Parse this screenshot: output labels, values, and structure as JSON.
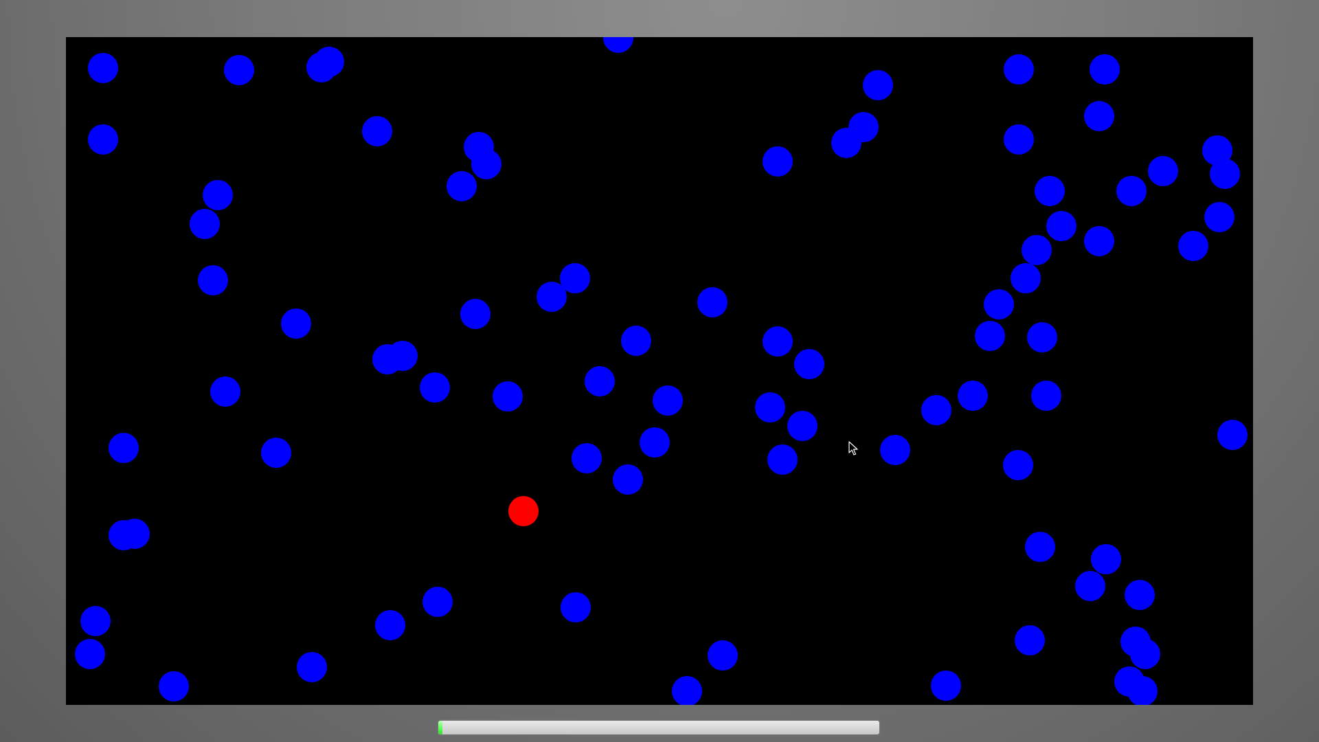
{
  "game": {
    "background_color": "#000000",
    "enemy_color": "#0000ff",
    "player_color": "#ff0000",
    "progress_fill_color": "#44ee44",
    "progress_fraction": 0.008,
    "dots_icon": "circle"
  }
}
